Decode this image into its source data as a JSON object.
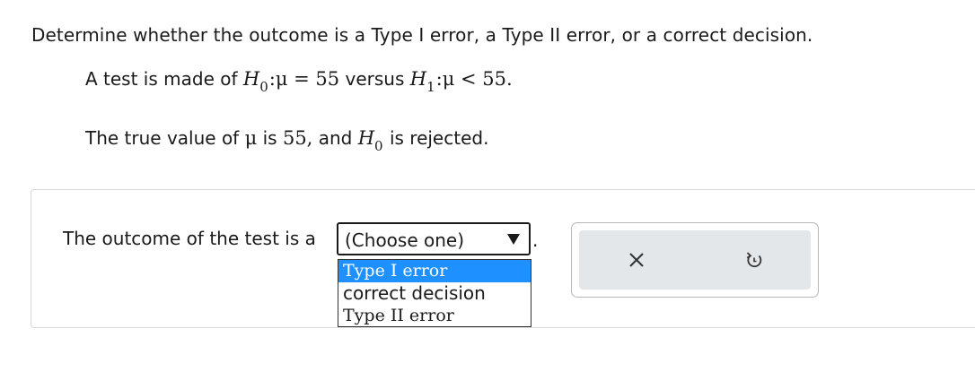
{
  "question": "Determine whether the outcome is a Type I error, a Type II error, or a correct decision.",
  "hypotheses": {
    "prefix": "A test is made of",
    "h0_letter": "H",
    "h0_sub": "0",
    "h0_rest": ":μ = 55",
    "versus": "versus",
    "h1_letter": "H",
    "h1_sub": "1",
    "h1_rest": ":μ < 55."
  },
  "truth": {
    "prefix": "The true value of",
    "mu": "μ",
    "is": "is",
    "value": "55,",
    "and": "and",
    "h_letter": "H",
    "h_sub": "0",
    "suffix": "is rejected."
  },
  "answer": {
    "prompt": "The outcome of the test is a",
    "select_value": "(Choose one)",
    "period": ".",
    "options": [
      "Type I error",
      "correct decision",
      "Type II error"
    ],
    "highlighted_option": "Type I error"
  },
  "tools": {
    "clear_icon": "close-icon",
    "undo_icon": "undo-icon"
  },
  "colors": {
    "highlight": "#1e90ff",
    "tools_bg": "#e4e7ea"
  }
}
